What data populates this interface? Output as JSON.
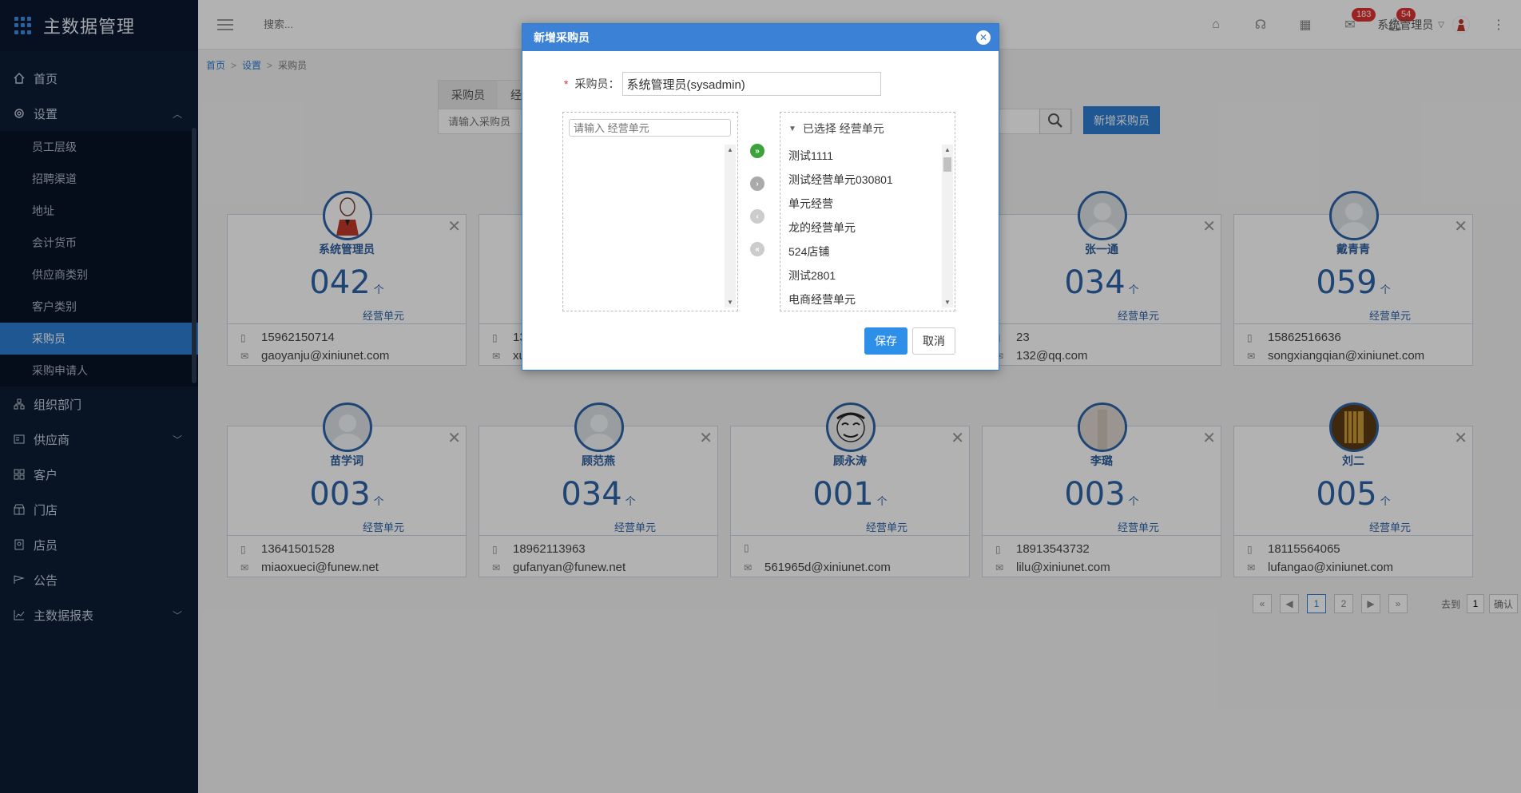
{
  "app": {
    "title": "主数据管理"
  },
  "sidebar": {
    "items": [
      {
        "label": "首页",
        "icon": "home-icon"
      },
      {
        "label": "设置",
        "icon": "gear-icon",
        "expanded": true
      },
      {
        "label": "组织部门",
        "icon": "org-icon"
      },
      {
        "label": "供应商",
        "icon": "supplier-icon"
      },
      {
        "label": "客户",
        "icon": "customer-icon"
      },
      {
        "label": "门店",
        "icon": "store-icon"
      },
      {
        "label": "店员",
        "icon": "clerk-icon"
      },
      {
        "label": "公告",
        "icon": "notice-icon"
      },
      {
        "label": "主数据报表",
        "icon": "chart-icon"
      }
    ],
    "sub_items": [
      "员工层级",
      "招聘渠道",
      "地址",
      "会计货币",
      "供应商类别",
      "客户类别",
      "采购员",
      "采购申请人"
    ],
    "active_sub": "采购员"
  },
  "topbar": {
    "search_placeholder": "搜索...",
    "badge_mail": "183",
    "badge_bell": "54",
    "user_name": "系统管理员"
  },
  "breadcrumb": {
    "home": "首页",
    "settings": "设置",
    "current": "采购员",
    "sep": ">"
  },
  "tabs": {
    "tab1": "采购员",
    "tab2": "经"
  },
  "search": {
    "placeholder": "请输入采购员"
  },
  "add_button": "新增采购员",
  "cards": [
    {
      "name": "系统管理员",
      "count": "042",
      "phone": "15962150714",
      "email": "gaoyanju@xiniunet.com"
    },
    {
      "name": "",
      "count": "",
      "phone": "13",
      "email": "xu"
    },
    {
      "name": "张一通",
      "count": "034",
      "phone": "23",
      "email": "132@qq.com"
    },
    {
      "name": "戴青青",
      "count": "059",
      "phone": "15862516636",
      "email": "songxiangqian@xiniunet.com"
    },
    {
      "name": "苗学词",
      "count": "003",
      "phone": "13641501528",
      "email": "miaoxueci@funew.net"
    },
    {
      "name": "顾范燕",
      "count": "034",
      "phone": "18962113963",
      "email": "gufanyan@funew.net"
    },
    {
      "name": "顾永涛",
      "count": "001",
      "phone": "",
      "email": "561965d@xiniunet.com"
    },
    {
      "name": "李璐",
      "count": "003",
      "phone": "18913543732",
      "email": "lilu@xiniunet.com"
    },
    {
      "name": "刘二",
      "count": "005",
      "phone": "18115564065",
      "email": "lufangao@xiniunet.com"
    }
  ],
  "card_unit": "个",
  "card_unit_label": "经营单元",
  "pager": {
    "first": "«",
    "prev": "◀",
    "pages": [
      "1",
      "2"
    ],
    "next": "▶",
    "last": "»",
    "goto_label": "去到",
    "goto_value": "1",
    "confirm": "确认"
  },
  "modal": {
    "title": "新增采购员",
    "buyer_label": "采购员：",
    "buyer_value": "系统管理员(sysadmin)",
    "left_placeholder": "请输入 经营单元",
    "right_header": "已选择 经营单元",
    "selected_units": [
      "测试1111",
      "测试经营单元030801",
      "单元经营",
      "龙的经营单元",
      "524店铺",
      "测试2801",
      "电商经营单元"
    ],
    "save": "保存",
    "cancel": "取消"
  }
}
